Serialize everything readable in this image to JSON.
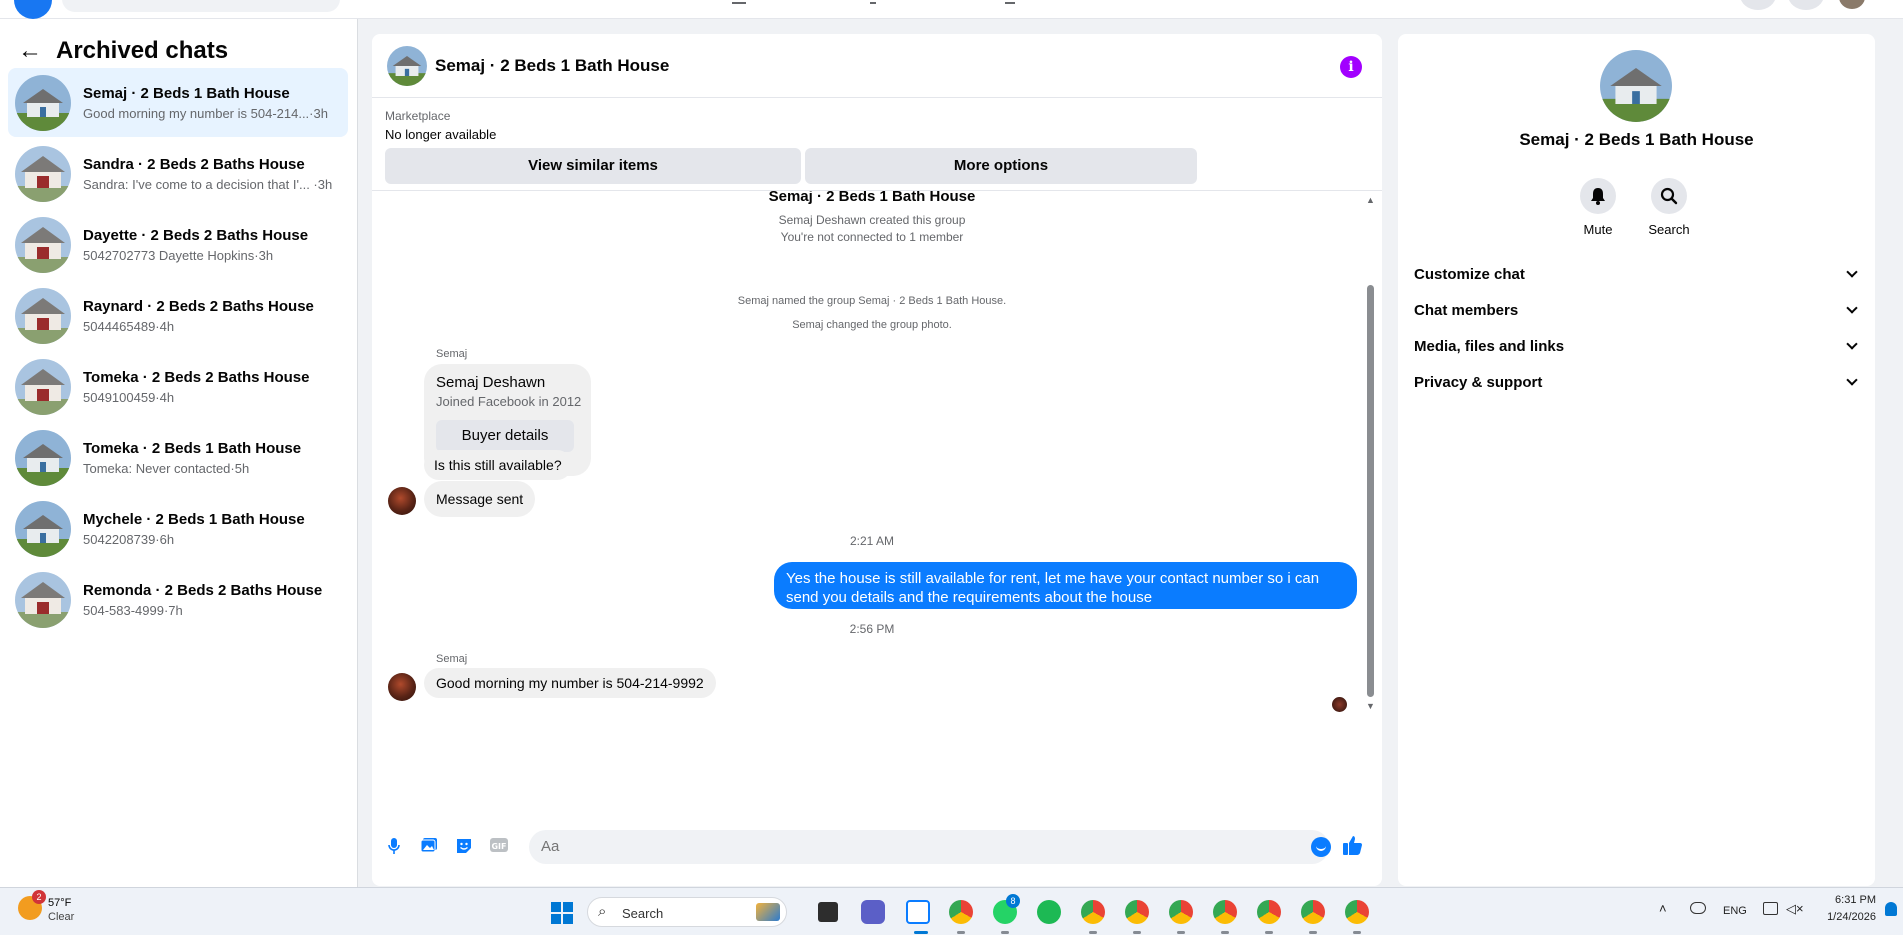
{
  "sidebar": {
    "title": "Archived chats",
    "chats": [
      {
        "name": "Semaj · 2 Beds 1 Bath House",
        "preview": "Good morning my number is 504-214...·3h"
      },
      {
        "name": "Sandra · 2 Beds 2 Baths House",
        "preview": "Sandra: I've come to a decision that I'... ·3h"
      },
      {
        "name": "Dayette · 2 Beds 2 Baths House",
        "preview": "5042702773 Dayette Hopkins·3h"
      },
      {
        "name": "Raynard · 2 Beds 2 Baths House",
        "preview": "5044465489·4h"
      },
      {
        "name": "Tomeka · 2 Beds 2 Baths House",
        "preview": "5049100459·4h"
      },
      {
        "name": "Tomeka · 2 Beds 1 Bath House",
        "preview": "Tomeka: Never contacted·5h"
      },
      {
        "name": "Mychele · 2 Beds 1 Bath House",
        "preview": "5042208739·6h"
      },
      {
        "name": "Remonda · 2 Beds 2 Baths House",
        "preview": "504-583-4999·7h"
      }
    ]
  },
  "conversation": {
    "title": "Semaj · 2 Beds 1 Bath House",
    "marketplace_label": "Marketplace",
    "listing_status": "No longer available",
    "view_similar": "View similar items",
    "more_options": "More options",
    "group_title": "Semaj · 2 Beds 1 Bath House",
    "sys_created": "Semaj Deshawn created this group",
    "sys_not_connected": "You're not connected to 1 member",
    "sys_named": "Semaj named the group Semaj · 2 Beds 1 Bath House.",
    "sys_photo": "Semaj changed the group photo.",
    "sender_1": "Semaj",
    "card_name": "Semaj Deshawn",
    "card_joined": "Joined Facebook in 2012",
    "buyer_details": "Buyer details",
    "msg_available": "Is this still available?",
    "msg_sent": "Message sent",
    "time_1": "2:21 AM",
    "msg_out": "Yes the house is still available for rent, let me have your contact number so i can send you details and the requirements about the house",
    "time_2": "2:56 PM",
    "sender_2": "Semaj",
    "msg_number": "Good morning my number is 504-214-9992",
    "input_placeholder": "Aa"
  },
  "details": {
    "name": "Semaj · 2 Beds 1 Bath House",
    "mute": "Mute",
    "search": "Search",
    "sections": [
      "Customize chat",
      "Chat members",
      "Media, files and links",
      "Privacy & support"
    ]
  },
  "taskbar": {
    "weather_badge": "2",
    "temperature": "57°F",
    "condition": "Clear",
    "search_label": "Search",
    "whatsapp_badge": "8",
    "language": "ENG",
    "time": "6:31 PM",
    "date": "1/24/2026"
  },
  "colors": {
    "accent": "#0a7cff",
    "info": "#a200ff",
    "selected_chat": "#e7f3ff"
  }
}
